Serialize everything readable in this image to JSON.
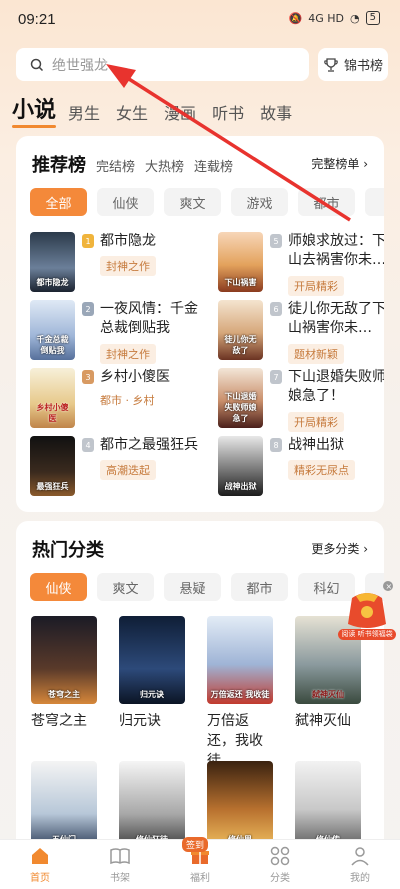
{
  "status": {
    "time": "09:21",
    "network": "4G HD",
    "battery": "5"
  },
  "search": {
    "placeholder": "绝世强龙"
  },
  "rank_button": {
    "label": "锦书榜"
  },
  "category_tabs": [
    "小说",
    "男生",
    "女生",
    "漫画",
    "听书",
    "故事"
  ],
  "recommend": {
    "title": "推荐榜",
    "subtabs": [
      "完结榜",
      "大热榜",
      "连载榜"
    ],
    "more": "完整榜单",
    "chips": [
      "全部",
      "仙侠",
      "爽文",
      "游戏",
      "都市",
      "玄"
    ],
    "items": [
      {
        "rank": "1",
        "title": "都市隐龙",
        "tag": "封神之作",
        "cover_text": "都市隐龙"
      },
      {
        "rank": "5",
        "title": "师娘求放过：下山去祸害你未…",
        "tag": "开局精彩",
        "cover_text": "下山祸害"
      },
      {
        "rank": "2",
        "title": "一夜风情：千金总裁倒贴我",
        "tag": "封神之作",
        "cover_text": "千金总裁倒贴我",
        "cover_badge": "原创"
      },
      {
        "rank": "6",
        "title": "徒儿你无敌了下山祸害你未…",
        "tag": "题材新颖",
        "cover_text": "徒儿你无敌了",
        "cover_badge": "原创"
      },
      {
        "rank": "3",
        "title": "乡村小傻医",
        "tag": "都市 · 乡村",
        "cover_text": "乡村小傻医",
        "cover_badge": "原创"
      },
      {
        "rank": "7",
        "title": "下山退婚失败师娘急了！",
        "tag": "开局精彩",
        "cover_text": "下山退婚失败师娘急了"
      },
      {
        "rank": "4",
        "title": "都市之最强狂兵",
        "tag": "高潮迭起",
        "cover_text": "最强狂兵",
        "cover_badge": "原创"
      },
      {
        "rank": "8",
        "title": "战神出狱",
        "tag": "精彩无尿点",
        "cover_text": "战神出狱"
      }
    ]
  },
  "hot": {
    "title": "热门分类",
    "more": "更多分类",
    "chips": [
      "仙侠",
      "爽文",
      "悬疑",
      "都市",
      "科幻",
      "玄"
    ],
    "books": [
      {
        "title": "苍穹之主",
        "cover_text": "苍穹之主"
      },
      {
        "title": "归元诀",
        "cover_text": "归元诀"
      },
      {
        "title": "万倍返还，我收徒…",
        "cover_text": "万倍返还 我收徒"
      },
      {
        "title": "弑神灭仙",
        "cover_text": "弑神灭仙",
        "cover_badge": "原创"
      },
      {
        "title": "",
        "cover_text": "五仙门"
      },
      {
        "title": "",
        "cover_text": "修仙狂徒"
      },
      {
        "title": "",
        "cover_text": "修仙界"
      },
      {
        "title": "",
        "cover_text": "修仙传",
        "cover_badge": "原创"
      }
    ]
  },
  "gift": {
    "label": "阅读 听书领福袋"
  },
  "bottom_nav": [
    {
      "label": "首页",
      "icon": "home-icon"
    },
    {
      "label": "书架",
      "icon": "bookshelf-icon"
    },
    {
      "label": "福利",
      "icon": "gift-icon",
      "badge": "签到"
    },
    {
      "label": "分类",
      "icon": "grid-icon"
    },
    {
      "label": "我的",
      "icon": "profile-icon"
    }
  ],
  "colors": {
    "accent": "#f1892f",
    "arrow": "#e8332e"
  }
}
